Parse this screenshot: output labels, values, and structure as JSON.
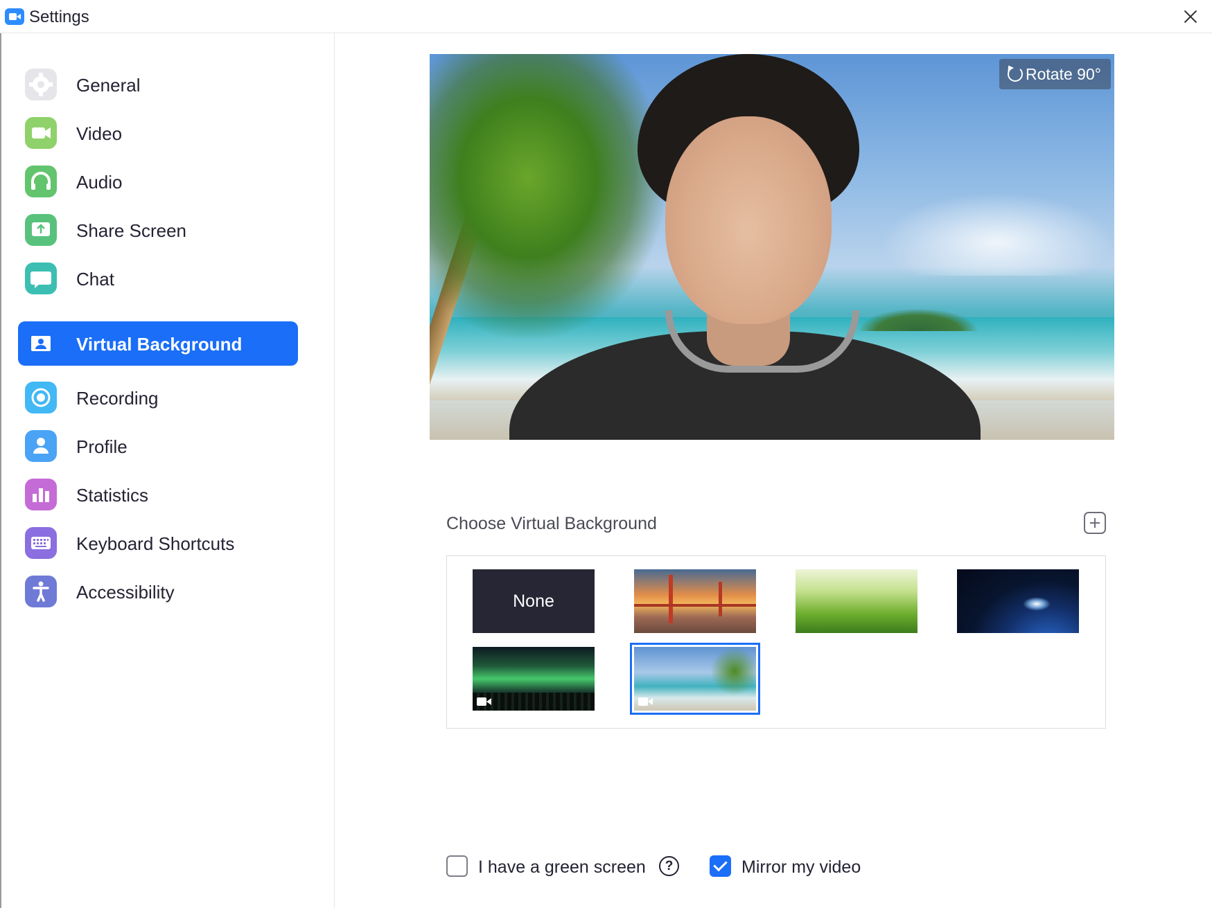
{
  "window": {
    "title": "Settings",
    "app_icon": "zoom-camera-icon",
    "close_icon": "close-icon"
  },
  "sidebar": {
    "items": [
      {
        "label": "General",
        "icon": "gear-icon",
        "color": "#e6e6ea",
        "active": false
      },
      {
        "label": "Video",
        "icon": "video-camera-icon",
        "color": "#8fd16a",
        "active": false
      },
      {
        "label": "Audio",
        "icon": "headphones-icon",
        "color": "#62c46d",
        "active": false
      },
      {
        "label": "Share Screen",
        "icon": "share-screen-icon",
        "color": "#58c27c",
        "active": false
      },
      {
        "label": "Chat",
        "icon": "chat-bubble-icon",
        "color": "#3cbfb2",
        "active": false
      },
      {
        "label": "Virtual Background",
        "icon": "portrait-icon",
        "color": "#1a6ef7",
        "active": true
      },
      {
        "label": "Recording",
        "icon": "record-icon",
        "color": "#42b8f5",
        "active": false
      },
      {
        "label": "Profile",
        "icon": "user-icon",
        "color": "#4aa3f5",
        "active": false
      },
      {
        "label": "Statistics",
        "icon": "bar-chart-icon",
        "color": "#c56bd6",
        "active": false
      },
      {
        "label": "Keyboard Shortcuts",
        "icon": "keyboard-icon",
        "color": "#8b6fe0",
        "active": false
      },
      {
        "label": "Accessibility",
        "icon": "accessibility-icon",
        "color": "#6f7ad6",
        "active": false
      }
    ]
  },
  "preview": {
    "rotate_label": "Rotate 90°",
    "rotate_icon": "rotate-icon"
  },
  "backgrounds": {
    "title": "Choose Virtual Background",
    "add_icon": "add-icon",
    "items": [
      {
        "label": "None",
        "kind": "none",
        "video": false,
        "selected": false
      },
      {
        "label": "",
        "kind": "golden-gate-bridge",
        "video": false,
        "selected": false
      },
      {
        "label": "",
        "kind": "grass",
        "video": false,
        "selected": false
      },
      {
        "label": "",
        "kind": "earth-from-space",
        "video": false,
        "selected": false
      },
      {
        "label": "",
        "kind": "aurora",
        "video": true,
        "selected": false
      },
      {
        "label": "",
        "kind": "beach-palm",
        "video": true,
        "selected": true
      }
    ]
  },
  "options": {
    "green_screen": {
      "label": "I have a green screen",
      "checked": false,
      "help": "?"
    },
    "mirror": {
      "label": "Mirror my video",
      "checked": true
    }
  },
  "colors": {
    "accent": "#1a6ef7",
    "text": "#232333"
  }
}
